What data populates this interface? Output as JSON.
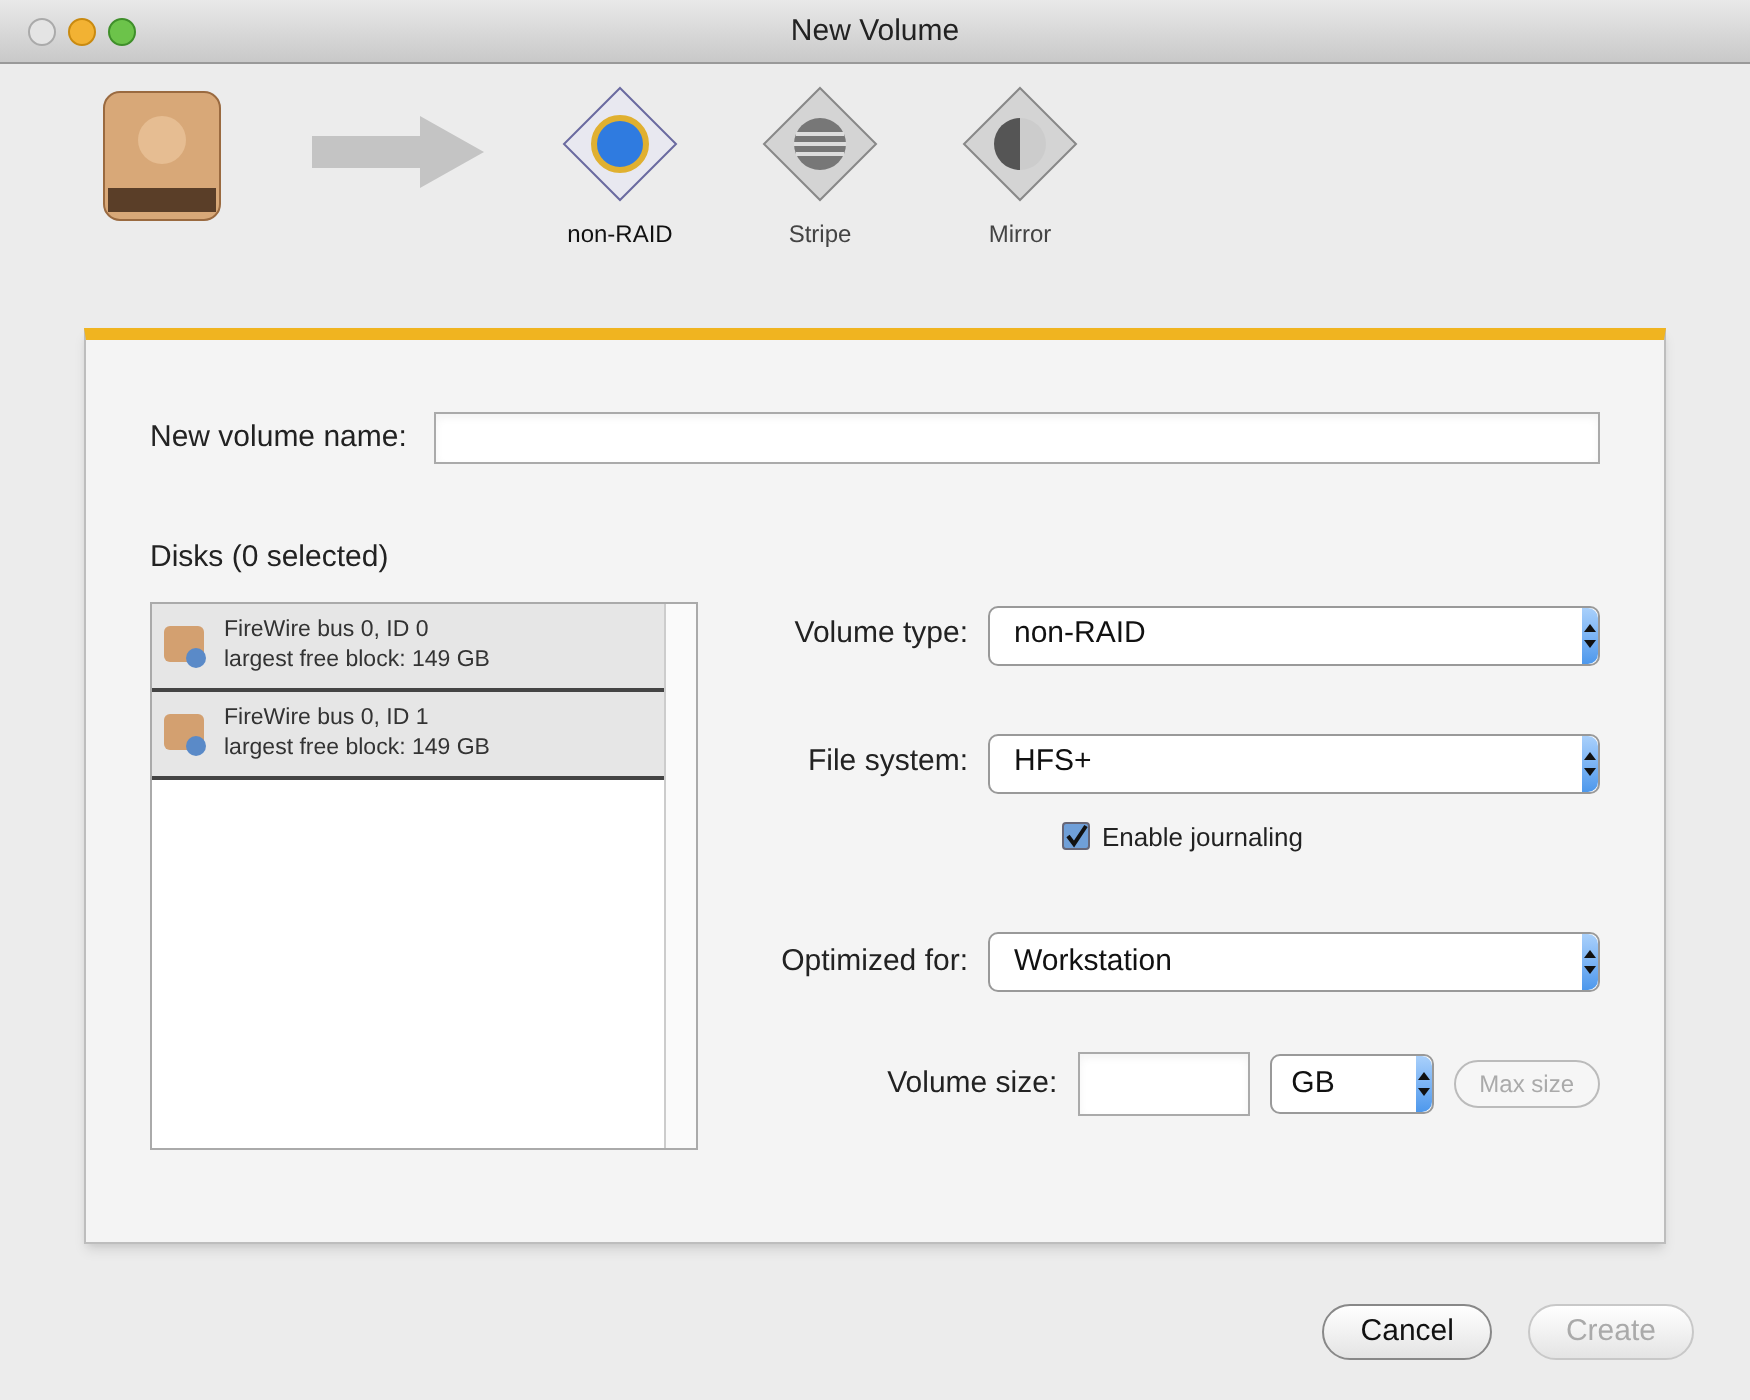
{
  "window": {
    "title": "New Volume"
  },
  "raid_types": [
    {
      "kind": "single",
      "label": "non-RAID",
      "selected": true
    },
    {
      "kind": "stripe",
      "label": "Stripe",
      "selected": false
    },
    {
      "kind": "mirror",
      "label": "Mirror",
      "selected": false
    }
  ],
  "name_field": {
    "label": "New volume name:"
  },
  "disks": {
    "label": "Disks (0 selected)",
    "items": [
      {
        "name": "FireWire bus 0, ID 0",
        "detail": "largest free block: 149 GB"
      },
      {
        "name": "FireWire bus 0, ID 1",
        "detail": "largest free block: 149 GB"
      }
    ]
  },
  "volume_type": {
    "label": "Volume type:",
    "value": "non-RAID"
  },
  "file_system": {
    "label": "File system:",
    "value": "HFS+"
  },
  "journaling": {
    "label": "Enable journaling",
    "checked": true
  },
  "optimized_for": {
    "label": "Optimized for:",
    "value": "Workstation"
  },
  "volume_size": {
    "label": "Volume size:",
    "unit": "GB",
    "max_button": {
      "label": "Max size",
      "disabled": true
    }
  },
  "buttons": [
    {
      "label": "Cancel",
      "disabled": false
    },
    {
      "label": "Create",
      "disabled": true
    }
  ]
}
